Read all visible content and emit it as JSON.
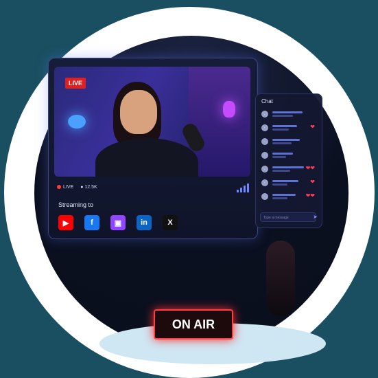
{
  "video": {
    "live_badge": "LIVE",
    "status_live": "LIVE",
    "viewers": "12.5K"
  },
  "streaming": {
    "title": "Streaming to",
    "platforms": [
      {
        "name": "youtube-icon",
        "glyph": "▶",
        "color": "#ff0000"
      },
      {
        "name": "facebook-icon",
        "glyph": "f",
        "color": "#1877f2"
      },
      {
        "name": "twitch-icon",
        "glyph": "▣",
        "color": "#9146ff"
      },
      {
        "name": "linkedin-icon",
        "glyph": "in",
        "color": "#0a66c2"
      },
      {
        "name": "x-icon",
        "glyph": "X",
        "color": "#111111"
      }
    ]
  },
  "chat": {
    "title": "Chat",
    "input_placeholder": "Type a message"
  },
  "sign": {
    "text": "ON AIR"
  }
}
